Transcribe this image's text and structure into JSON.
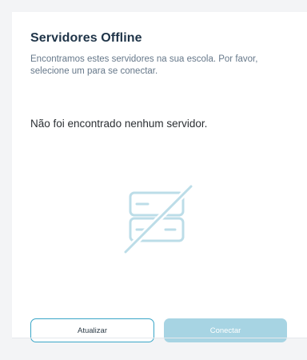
{
  "dialog": {
    "title": "Servidores Offline",
    "subtitle": "Encontramos estes servidores na sua escola. Por favor, selecione um para se conectar.",
    "empty_message": "Não foi encontrado nenhum servidor.",
    "illustration_icon": "server-off-icon"
  },
  "actions": {
    "refresh_label": "Atualizar",
    "connect_label": "Conectar",
    "connect_disabled": true
  },
  "colors": {
    "title": "#1f3448",
    "accent": "#3aa6c8",
    "disabled_button": "#a7d4e3",
    "illustration": "#bcdde8"
  }
}
